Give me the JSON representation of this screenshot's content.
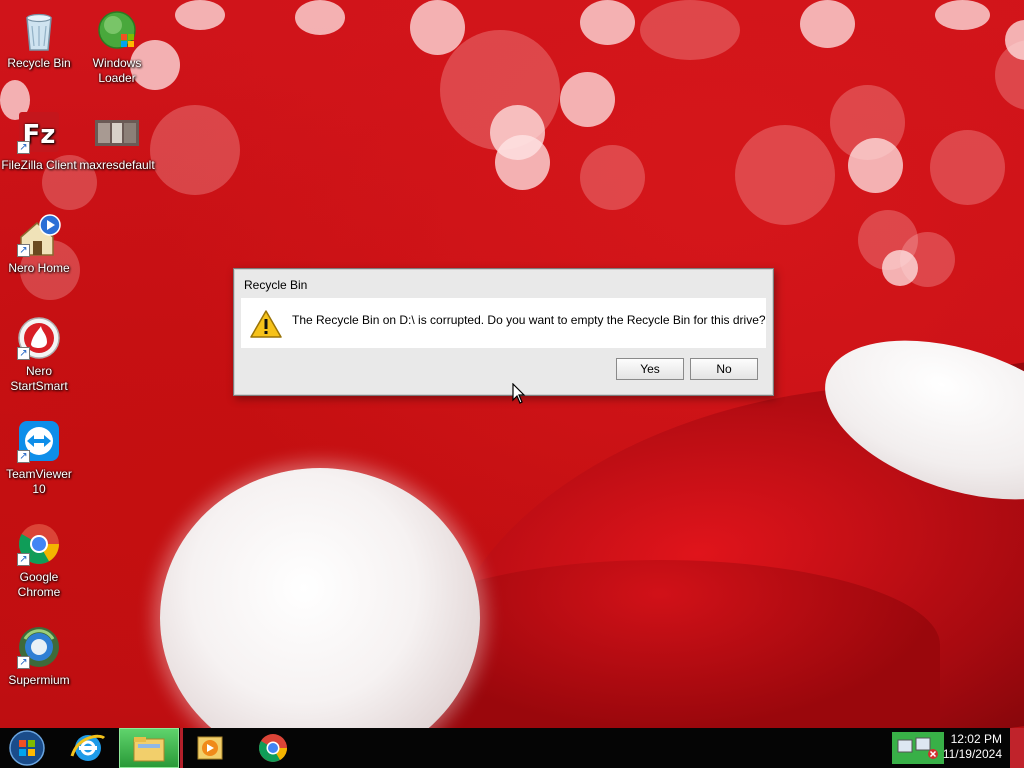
{
  "desktop_icons": [
    {
      "label": "Recycle Bin",
      "icon": "recycle-bin-icon"
    },
    {
      "label": "Windows Loader",
      "icon": "windows-loader-icon"
    },
    {
      "label": "FileZilla Client",
      "icon": "filezilla-icon"
    },
    {
      "label": "maxresdefault",
      "icon": "image-thumbnail-icon"
    },
    {
      "label": "Nero Home",
      "icon": "nero-home-icon"
    },
    {
      "label": "Nero StartSmart",
      "icon": "nero-startsmart-icon"
    },
    {
      "label": "TeamViewer 10",
      "icon": "teamviewer-icon"
    },
    {
      "label": "Google Chrome",
      "icon": "chrome-icon"
    },
    {
      "label": "Supermium",
      "icon": "supermium-icon"
    }
  ],
  "dialog": {
    "title": "Recycle Bin",
    "message": "The Recycle Bin on D:\\ is corrupted. Do you want to empty the Recycle Bin for this drive?",
    "yes_label": "Yes",
    "no_label": "No"
  },
  "taskbar": {
    "items": [
      "start-orb",
      "internet-explorer-icon",
      "file-explorer-icon",
      "media-player-icon",
      "chrome-icon"
    ],
    "clock_time": "12:02 PM",
    "clock_date": "11/19/2024"
  },
  "colors": {
    "desktop_red": "#c81015",
    "taskbar": "#050505",
    "dialog_bg": "#e9e9e9",
    "explorer_active": "#35b84a"
  }
}
